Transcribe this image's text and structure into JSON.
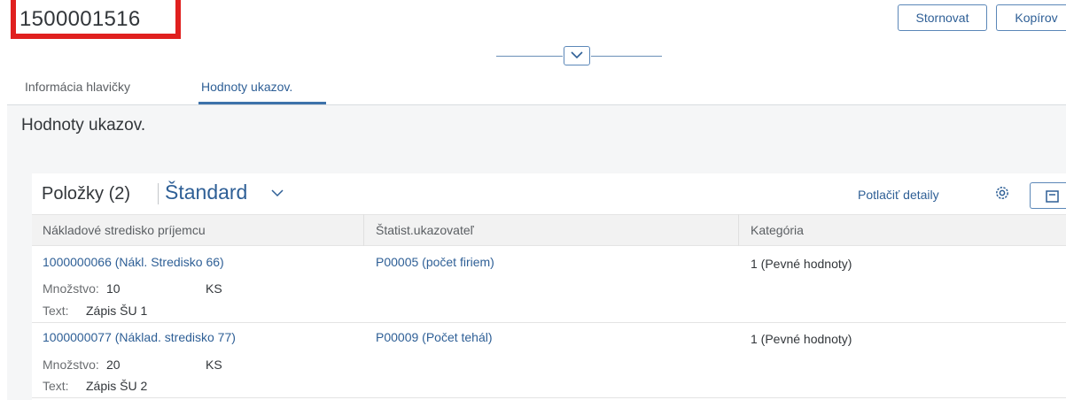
{
  "header": {
    "document_id": "1500001516",
    "actions": {
      "cancel_label": "Stornovat",
      "copy_label": "Kopírov"
    }
  },
  "tabs": [
    {
      "label": "Informácia hlavičky",
      "selected": false
    },
    {
      "label": "Hodnoty ukazov.",
      "selected": true
    }
  ],
  "section": {
    "title": "Hodnoty ukazov."
  },
  "table": {
    "title": "Položky (2)",
    "variant": "Štandard",
    "hide_details_label": "Potlačiť detaily",
    "columns": [
      "Nákladové stredisko príjemcu",
      "Štatist.ukazovateľ",
      "Kategória"
    ],
    "rows": [
      {
        "cost_center": "1000000066 (Nákl. Stredisko 66)",
        "statistical_key_figure": "P00005 (počet firiem)",
        "category": "1 (Pevné hodnoty)",
        "quantity_label": "Množstvo:",
        "quantity": "10",
        "unit": "KS",
        "text_label": "Text:",
        "text": "Zápis ŠU 1"
      },
      {
        "cost_center": "1000000077 (Náklad. stredisko 77)",
        "statistical_key_figure": "P00009 (Počet tehál)",
        "category": "1 (Pevné hodnoty)",
        "quantity_label": "Množstvo:",
        "quantity": "20",
        "unit": "KS",
        "text_label": "Text:",
        "text": "Zápis ŠU 2"
      }
    ]
  },
  "colors": {
    "accent": "#2e5f96",
    "highlight_frame": "#e0201f",
    "header_background": "#f2f2f2"
  },
  "icons": [
    "chevron-down-icon",
    "settings-icon",
    "export-icon"
  ]
}
